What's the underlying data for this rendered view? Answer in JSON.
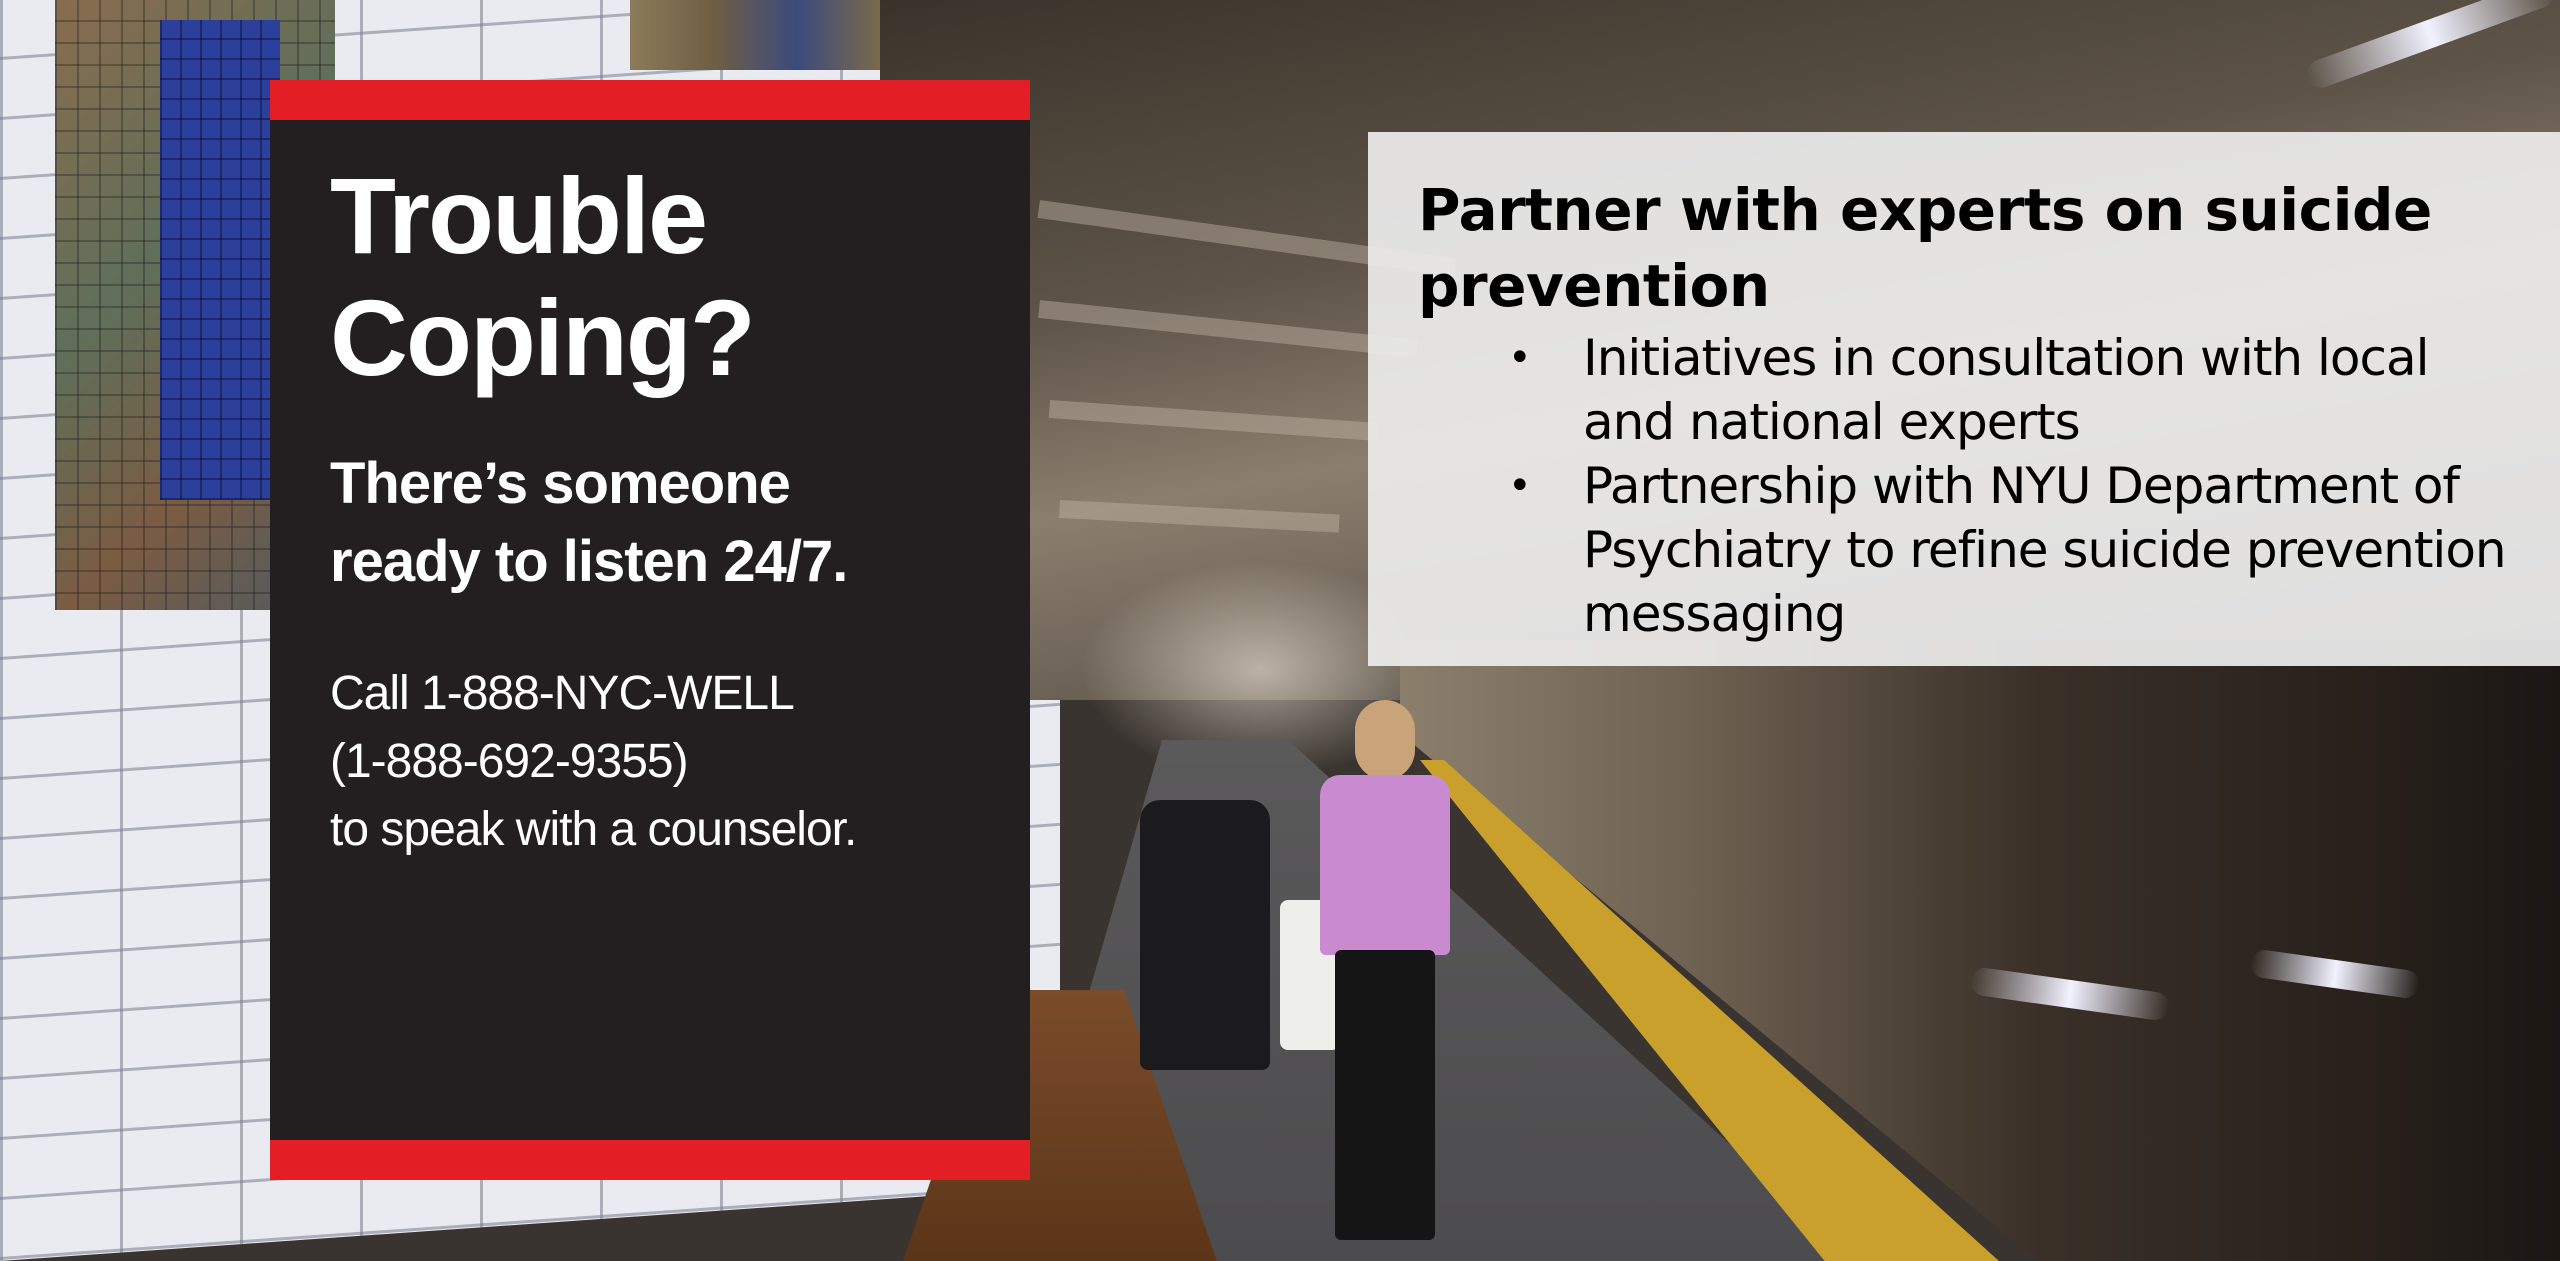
{
  "poster": {
    "headline": "Trouble\nCoping?",
    "subheadline": "There’s someone\nready to listen 24/7.",
    "call_text": "Call 1-888-NYC-WELL\n(1-888-692-9355)\nto speak with a counselor.",
    "accent_color": "#e31e24",
    "background_color": "#231f20"
  },
  "panel": {
    "title": "Partner with experts on suicide prevention",
    "bullets": [
      "Initiatives in consultation with local and national experts",
      "Partnership with NYU Department of Psychiatry to refine suicide prevention messaging"
    ],
    "bullet_glyph": "•"
  }
}
